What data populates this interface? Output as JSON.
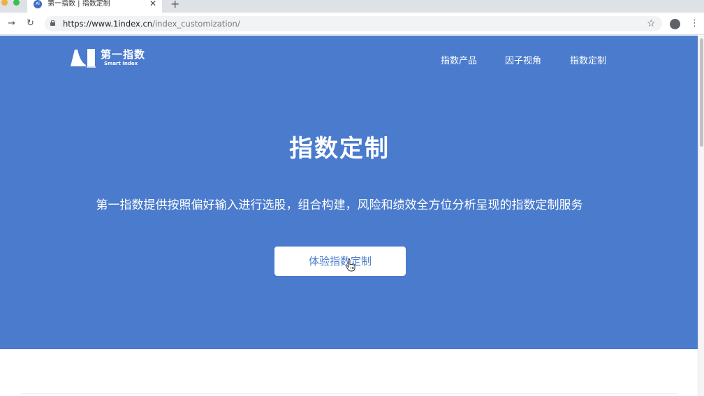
{
  "browser": {
    "tab_title": "第一指数 | 指数定制",
    "favicon_text": "AI",
    "url_host": "https://www.1index.cn",
    "url_path": "/index_customization/",
    "new_tab_label": "+",
    "close_tab_label": "✕"
  },
  "site": {
    "logo_cn": "第一指数",
    "logo_en": "Smart Index",
    "nav": [
      {
        "label": "指数产品"
      },
      {
        "label": "因子视角"
      },
      {
        "label": "指数定制"
      }
    ]
  },
  "hero": {
    "title": "指数定制",
    "description": "第一指数提供按照偏好输入进行选股，组合构建，风险和绩效全方位分析呈现的指数定制服务",
    "cta_label": "体验指数定制"
  },
  "colors": {
    "hero_bg": "#4a7bcd",
    "cta_text": "#4a7bcd",
    "white": "#ffffff"
  }
}
